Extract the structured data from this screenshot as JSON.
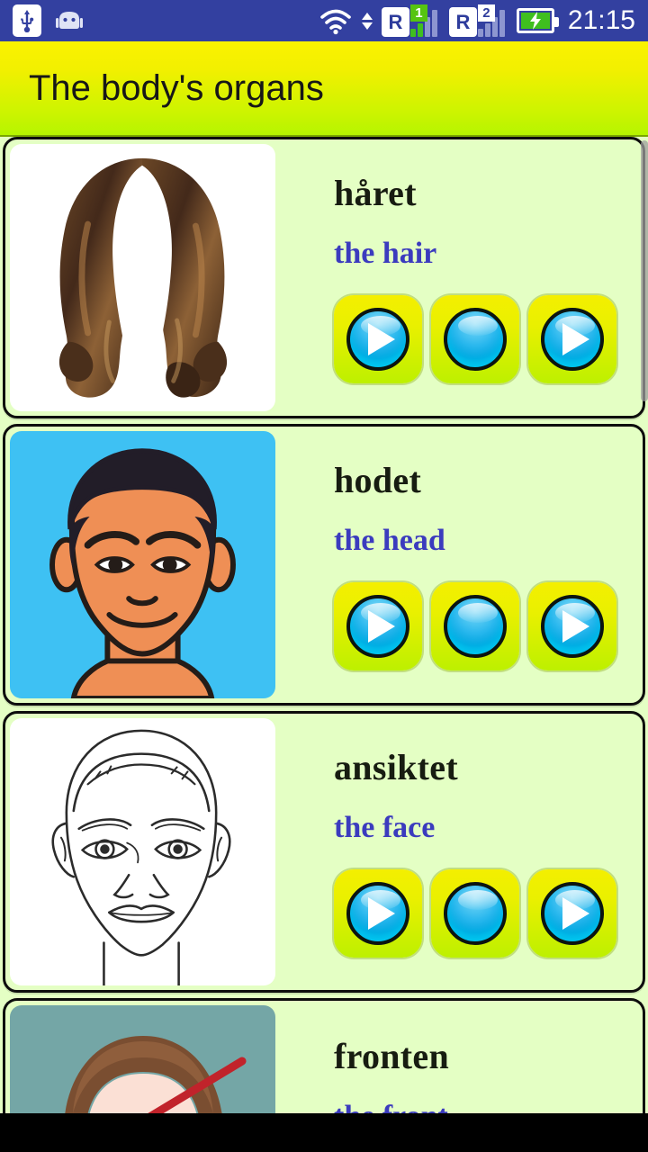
{
  "status_bar": {
    "background_color": "#3340a0",
    "left_icons": [
      {
        "name": "usb-icon",
        "label": "USB"
      },
      {
        "name": "android-icon",
        "label": "Android"
      }
    ],
    "wifi": {
      "name": "wifi-icon",
      "label": "Wi-Fi"
    },
    "data_transfer": {
      "name": "data-transfer-arrows-icon",
      "label": "up/down"
    },
    "sims": [
      {
        "roaming_label": "R",
        "sim_number": "1",
        "signal_bars": 2,
        "badge_color": "#56c410"
      },
      {
        "roaming_label": "R",
        "sim_number": "2",
        "signal_bars": 2,
        "badge_color": "#ffffff"
      }
    ],
    "battery": {
      "name": "battery-charging-icon",
      "charging": true,
      "color": "#3fbf1f"
    },
    "clock": "21:15"
  },
  "header": {
    "title": "The body's organs",
    "gradient_top": "#fbf200",
    "gradient_bottom": "#b6f500",
    "text_color": "#171717"
  },
  "list": {
    "background_color": "#e4ffc4",
    "card_border_color": "#0d0d0d",
    "native_text_color": "#171c11",
    "translation_text_color": "#3b3bbe",
    "button_gradient_top": "#f4ef00",
    "button_gradient_bottom": "#bdf000",
    "button_circle_color": "#00a6e0",
    "items": [
      {
        "native": "håret",
        "translation": "the hair",
        "image_name": "hair-illustration",
        "image_background": "#ffffff",
        "buttons": [
          {
            "name": "play-native-button",
            "icon": "play-icon"
          },
          {
            "name": "record-button",
            "icon": "circle-icon"
          },
          {
            "name": "play-translation-button",
            "icon": "play-icon"
          }
        ]
      },
      {
        "native": "hodet",
        "translation": "the head",
        "image_name": "head-illustration",
        "image_background": "#3ec1f3",
        "buttons": [
          {
            "name": "play-native-button",
            "icon": "play-icon"
          },
          {
            "name": "record-button",
            "icon": "circle-icon"
          },
          {
            "name": "play-translation-button",
            "icon": "play-icon"
          }
        ]
      },
      {
        "native": "ansiktet",
        "translation": "the face",
        "image_name": "face-line-drawing",
        "image_background": "#ffffff",
        "buttons": [
          {
            "name": "play-native-button",
            "icon": "play-icon"
          },
          {
            "name": "record-button",
            "icon": "circle-icon"
          },
          {
            "name": "play-translation-button",
            "icon": "play-icon"
          }
        ]
      },
      {
        "native": "fronten",
        "translation": "the front",
        "image_name": "forehead-illustration-with-arrow",
        "image_background": "#74a6a6",
        "buttons": []
      }
    ]
  },
  "scrollbar": {
    "name": "vertical-scrollbar",
    "color": "#9e9e9e"
  },
  "nav_bar": {
    "background_color": "#000000"
  }
}
